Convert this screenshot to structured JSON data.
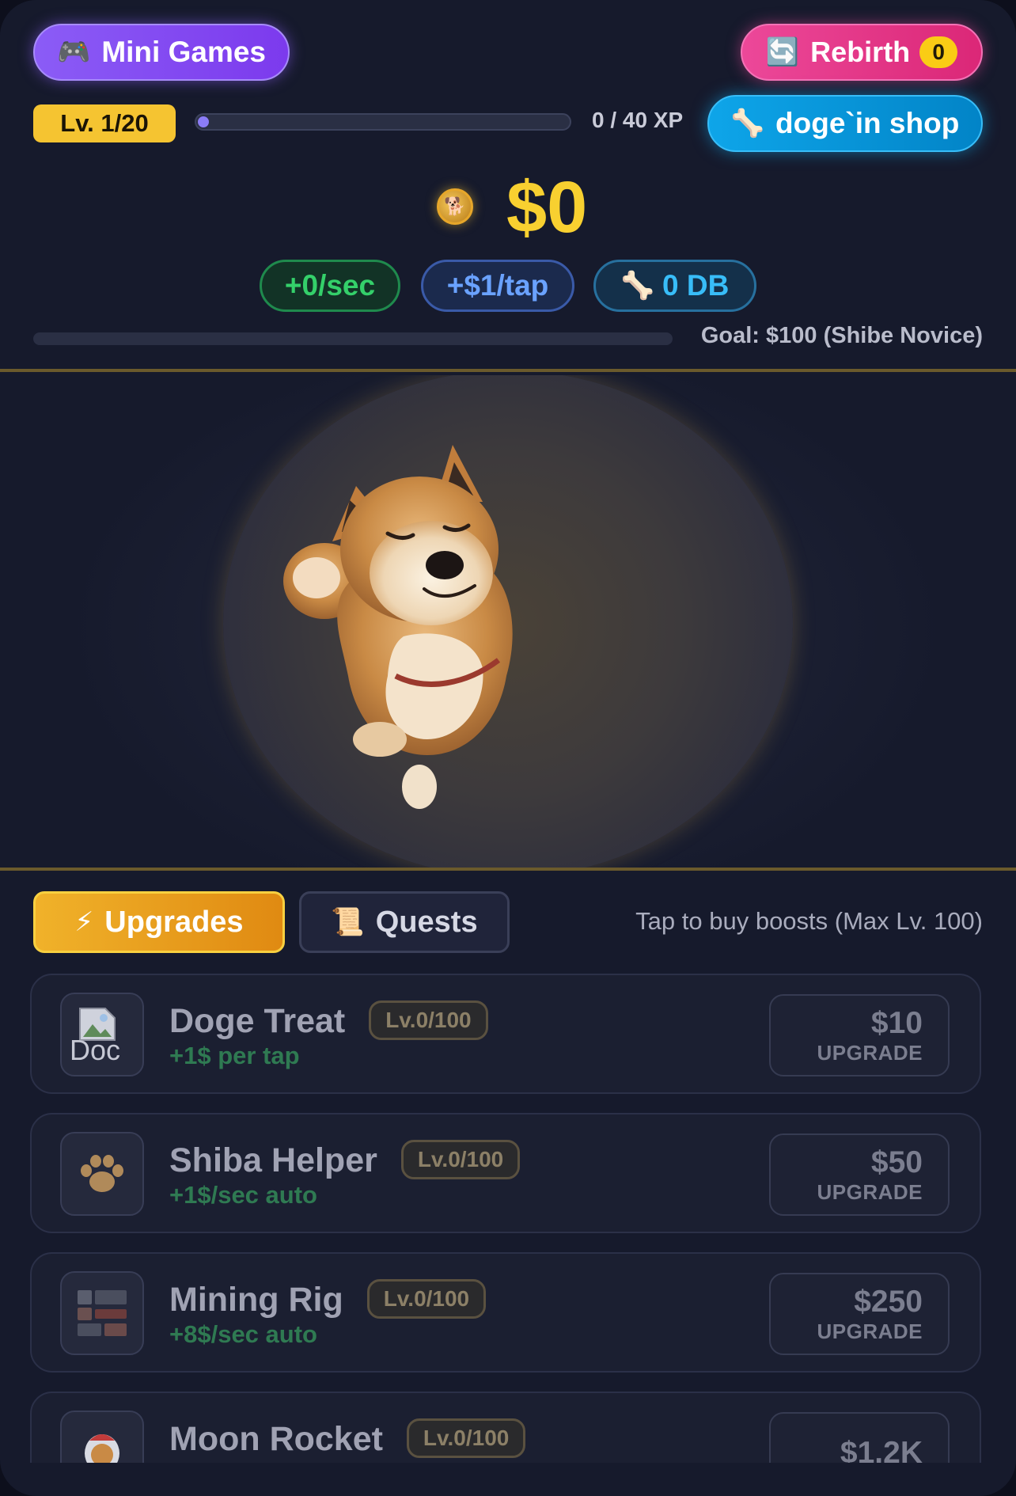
{
  "header": {
    "mini_games": {
      "icon": "gamepad-icon",
      "label": "Mini Games"
    },
    "rebirth": {
      "icon": "rebirth-cycle-icon",
      "label": "Rebirth",
      "count": "0"
    },
    "level": "Lv. 1/20",
    "xp": {
      "text": "0 / 40 XP",
      "progress_fraction": 0.0
    },
    "shop": {
      "icon": "bone-icon",
      "label": "doge`in shop"
    },
    "balance": "$0",
    "stats": {
      "per_sec": "+0/sec",
      "per_tap": "+$1/tap",
      "db": {
        "icon": "bone-icon",
        "label": "0 DB"
      }
    },
    "goal": {
      "text": "Goal: $100 (Shibe Novice)",
      "progress_fraction": 0.0
    }
  },
  "arena": {
    "character": "shiba-inu-doge"
  },
  "tabs": {
    "upgrades": {
      "icon": "lightning-icon",
      "label": "Upgrades",
      "active": true
    },
    "quests": {
      "icon": "scroll-icon",
      "label": "Quests",
      "active": false
    },
    "hint": "Tap to buy boosts (Max Lv. 100)"
  },
  "upgrades": [
    {
      "name": "Doge Treat",
      "level": "Lv.0/100",
      "effect": "+1$ per tap",
      "price": "$10",
      "action": "UPGRADE",
      "icon": "broken-image-icon",
      "alt_text": "Doc"
    },
    {
      "name": "Shiba Helper",
      "level": "Lv.0/100",
      "effect": "+1$/sec auto",
      "price": "$50",
      "action": "UPGRADE",
      "icon": "paw-icon"
    },
    {
      "name": "Mining Rig",
      "level": "Lv.0/100",
      "effect": "+8$/sec auto",
      "price": "$250",
      "action": "UPGRADE",
      "icon": "mining-rig-icon"
    },
    {
      "name": "Moon Rocket",
      "level": "Lv.0/100",
      "effect": "",
      "price": "$1.2K",
      "action": "",
      "icon": "astronaut-doge-icon"
    }
  ],
  "colors": {
    "background": "#161a2c",
    "gold": "#f8d030",
    "purple": "#8b5cf6",
    "pink": "#ec4899",
    "sky": "#0ea5e9",
    "green": "#34d06a"
  }
}
